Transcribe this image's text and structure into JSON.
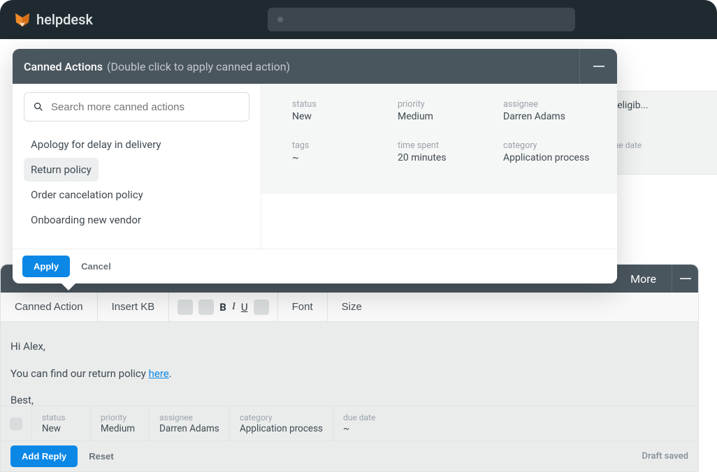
{
  "app": {
    "name": "helpdesk"
  },
  "backgroundTicket": {
    "subject": "n eligib...",
    "dueDate": {
      "label": "due date",
      "value": "~"
    }
  },
  "cannedActions": {
    "title": "Canned Actions",
    "subtitle": "(Double click to apply canned action)",
    "searchPlaceholder": "Search more canned actions",
    "items": [
      {
        "label": "Apology for delay in delivery"
      },
      {
        "label": "Return policy"
      },
      {
        "label": "Order cancelation policy"
      },
      {
        "label": "Onboarding new vendor"
      }
    ],
    "preview": {
      "status": {
        "label": "status",
        "value": "New"
      },
      "priority": {
        "label": "priority",
        "value": "Medium"
      },
      "assignee": {
        "label": "assignee",
        "value": "Darren Adams"
      },
      "tags": {
        "label": "tags",
        "value": "~"
      },
      "timeSpent": {
        "label": "time spent",
        "value": "20 minutes"
      },
      "category": {
        "label": "category",
        "value": "Application process"
      }
    },
    "applyLabel": "Apply",
    "cancelLabel": "Cancel"
  },
  "editor": {
    "moreLabel": "More",
    "toolbar": {
      "cannedActionLabel": "Canned Action",
      "insertKbLabel": "Insert KB",
      "fontLabel": "Font",
      "sizeLabel": "Size",
      "boldGlyph": "B",
      "italicGlyph": "I",
      "underlineGlyph": "U"
    },
    "body": {
      "greeting": "Hi Alex,",
      "line2a": "You can find our return policy ",
      "linkText": "here",
      "line2b": ".",
      "signoff": "Best,"
    },
    "meta": {
      "status": {
        "label": "status",
        "value": "New"
      },
      "priority": {
        "label": "priority",
        "value": "Medium"
      },
      "assignee": {
        "label": "assignee",
        "value": "Darren Adams"
      },
      "category": {
        "label": "category",
        "value": "Application process"
      },
      "dueDate": {
        "label": "due date",
        "value": "~"
      }
    },
    "addReplyLabel": "Add Reply",
    "resetLabel": "Reset",
    "draftSavedLabel": "Draft saved"
  }
}
